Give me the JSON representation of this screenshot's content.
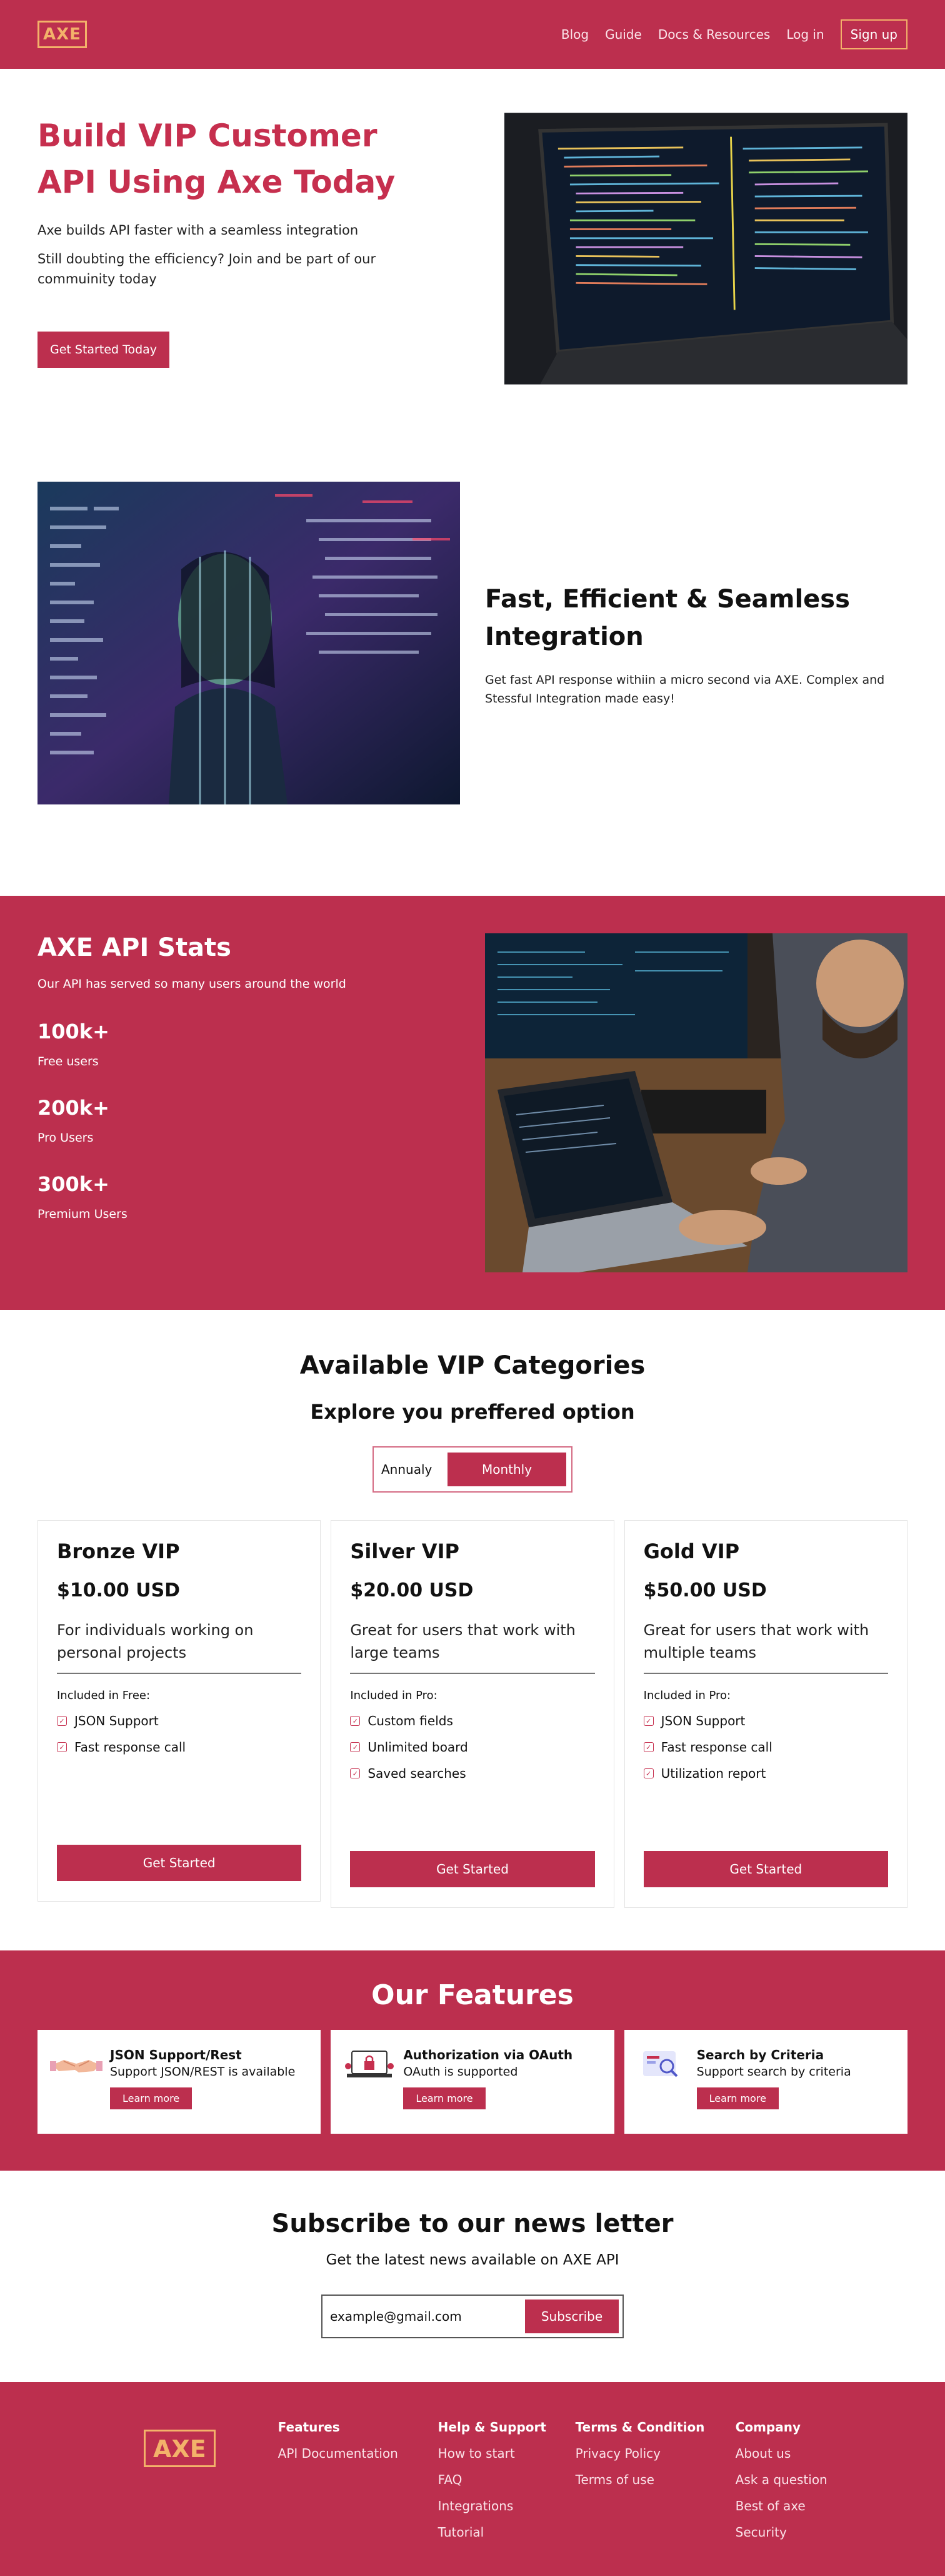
{
  "nav": {
    "logo": "AXE",
    "links": [
      "Blog",
      "Guide",
      "Docs & Resources",
      "Log in"
    ],
    "signup": "Sign up"
  },
  "hero": {
    "title": "Build VIP Customer API Using Axe Today",
    "p1": "Axe builds API faster with a seamless integration",
    "p2": "Still doubting the efficiency? Join and be part of our commuinity today",
    "cta": "Get Started Today"
  },
  "integration": {
    "title": "Fast, Efficient & Seamless Integration",
    "p": "Get fast API response withiin a micro second via AXE. Complex and Stessful Integration made easy!"
  },
  "stats": {
    "title": "AXE API Stats",
    "subtitle": "Our API has served so many users around the world",
    "items": [
      {
        "num": "100k+",
        "label": "Free users"
      },
      {
        "num": "200k+",
        "label": "Pro Users"
      },
      {
        "num": "300k+",
        "label": "Premium Users"
      }
    ]
  },
  "pricing": {
    "title": "Available VIP Categories",
    "subtitle": "Explore you preffered option",
    "toggle": {
      "annual": "Annualy",
      "monthly": "Monthly"
    },
    "plans": [
      {
        "name": "Bronze VIP",
        "price": "$10.00 USD",
        "desc": "For individuals working on personal projects",
        "included": "Included in Free:",
        "features": [
          "JSON Support",
          "Fast response call"
        ],
        "cta": "Get Started"
      },
      {
        "name": "Silver VIP",
        "price": "$20.00 USD",
        "desc": "Great for users that work with large teams",
        "included": "Included in Pro:",
        "features": [
          "Custom fields",
          "Unlimited board",
          "Saved searches"
        ],
        "cta": "Get Started"
      },
      {
        "name": "Gold VIP",
        "price": "$50.00 USD",
        "desc": "Great for users that work with multiple teams",
        "included": "Included in Pro:",
        "features": [
          "JSON Support",
          "Fast response call",
          "Utilization report"
        ],
        "cta": "Get Started"
      }
    ]
  },
  "features": {
    "title": "Our Features",
    "items": [
      {
        "title": "JSON Support/Rest",
        "desc": "Support JSON/REST is available",
        "cta": "Learn more",
        "icon": "handshake-icon"
      },
      {
        "title": "Authorization via OAuth",
        "desc": "OAuth is supported",
        "cta": "Learn more",
        "icon": "lock-laptop-icon"
      },
      {
        "title": "Search by Criteria",
        "desc": "Support search by criteria",
        "cta": "Learn more",
        "icon": "search-window-icon"
      }
    ]
  },
  "subscribe": {
    "title": "Subscribe to our news letter",
    "subtitle": "Get the latest news available on AXE API",
    "input": "example@gmail.com",
    "button": "Subscribe"
  },
  "footer": {
    "logo": "AXE",
    "columns": [
      {
        "heading": "Features",
        "items": [
          "API Documentation"
        ]
      },
      {
        "heading": "Help & Support",
        "items": [
          "How to start",
          "FAQ",
          "Integrations",
          "Tutorial"
        ]
      },
      {
        "heading": "Terms & Condition",
        "items": [
          "Privacy Policy",
          "Terms of use"
        ]
      },
      {
        "heading": "Company",
        "items": [
          "About us",
          "Ask a question",
          "Best of axe",
          "Security"
        ]
      }
    ]
  },
  "colors": {
    "primary": "#bc2f4e",
    "heading_red": "#c62f4e",
    "logo_orange": "#f3b26a"
  }
}
